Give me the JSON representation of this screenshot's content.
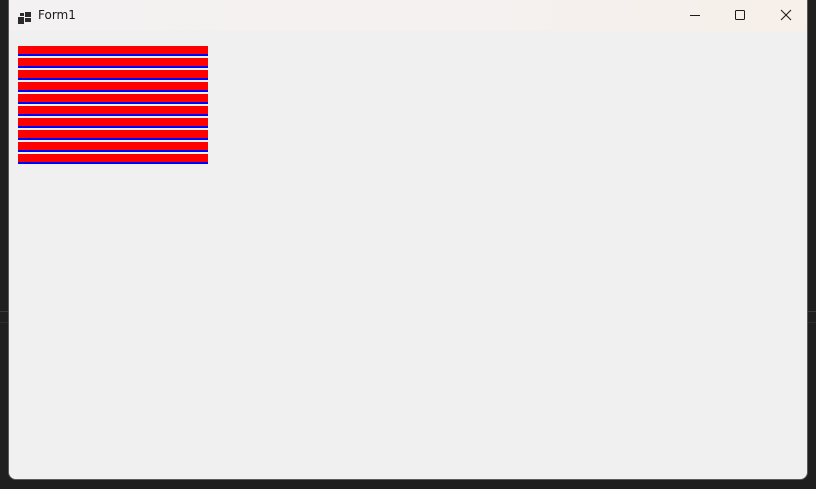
{
  "window": {
    "title": "Form1",
    "icon": "windows-forms-app-icon",
    "controls": {
      "minimize_icon": "minimize-icon",
      "maximize_icon": "maximize-icon",
      "close_icon": "close-icon"
    }
  },
  "client": {
    "stripe_count": 10,
    "stripe_fill_color": "#ff0000",
    "stripe_border_color": "#0000ff",
    "background_color": "#f0f0f0"
  }
}
